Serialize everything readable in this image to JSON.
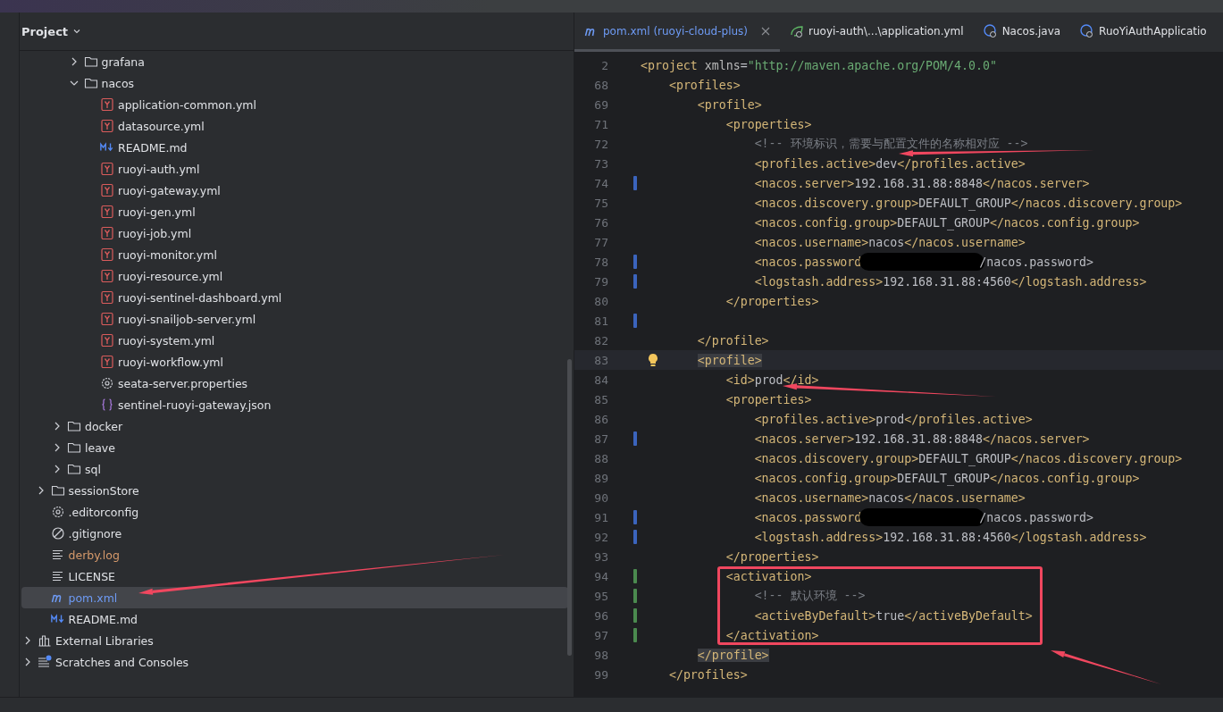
{
  "project_panel": {
    "title": "Project",
    "tree": [
      {
        "children": [
          {
            "children": [
              {
                "children": [
                  {
                    "label": "grafana",
                    "kind": "folder",
                    "expanded": false,
                    "selected": false
                  },
                  {
                    "label": "nacos",
                    "kind": "folder",
                    "expanded": true,
                    "selected": false,
                    "children": [
                      {
                        "label": "application-common.yml",
                        "kind": "yaml",
                        "selected": false
                      },
                      {
                        "label": "datasource.yml",
                        "kind": "yaml",
                        "selected": false
                      },
                      {
                        "label": "README.md",
                        "kind": "markdown",
                        "selected": false
                      },
                      {
                        "label": "ruoyi-auth.yml",
                        "kind": "yaml",
                        "selected": false
                      },
                      {
                        "label": "ruoyi-gateway.yml",
                        "kind": "yaml",
                        "selected": false
                      },
                      {
                        "label": "ruoyi-gen.yml",
                        "kind": "yaml",
                        "selected": false
                      },
                      {
                        "label": "ruoyi-job.yml",
                        "kind": "yaml",
                        "selected": false
                      },
                      {
                        "label": "ruoyi-monitor.yml",
                        "kind": "yaml",
                        "selected": false
                      },
                      {
                        "label": "ruoyi-resource.yml",
                        "kind": "yaml",
                        "selected": false
                      },
                      {
                        "label": "ruoyi-sentinel-dashboard.yml",
                        "kind": "yaml",
                        "selected": false
                      },
                      {
                        "label": "ruoyi-snailjob-server.yml",
                        "kind": "yaml",
                        "selected": false
                      },
                      {
                        "label": "ruoyi-system.yml",
                        "kind": "yaml",
                        "selected": false
                      },
                      {
                        "label": "ruoyi-workflow.yml",
                        "kind": "yaml",
                        "selected": false
                      },
                      {
                        "label": "seata-server.properties",
                        "kind": "settings",
                        "selected": false
                      },
                      {
                        "label": "sentinel-ruoyi-gateway.json",
                        "kind": "json",
                        "selected": false
                      }
                    ]
                  }
                ]
              },
              {
                "label": "docker",
                "kind": "folder",
                "expanded": false,
                "selected": false
              },
              {
                "label": "leave",
                "kind": "folder",
                "expanded": false,
                "selected": false
              },
              {
                "label": "sql",
                "kind": "folder",
                "expanded": false,
                "selected": false
              }
            ]
          },
          {
            "label": "sessionStore",
            "kind": "folder",
            "expanded": false,
            "selected": false
          },
          {
            "label": ".editorconfig",
            "kind": "settings",
            "selected": false
          },
          {
            "label": ".gitignore",
            "kind": "ignore",
            "selected": false
          },
          {
            "label": "derby.log",
            "kind": "text",
            "ignored": true,
            "selected": false
          },
          {
            "label": "LICENSE",
            "kind": "text",
            "selected": false
          },
          {
            "label": "pom.xml",
            "kind": "maven",
            "selected": true
          },
          {
            "label": "README.md",
            "kind": "markdown",
            "selected": false
          }
        ]
      },
      {
        "label": "External Libraries",
        "kind": "libraries",
        "expanded": false,
        "selected": false
      },
      {
        "label": "Scratches and Consoles",
        "kind": "scratches",
        "expanded": false,
        "selected": false
      }
    ]
  },
  "editor": {
    "tabs": [
      {
        "label": "pom.xml (ruoyi-cloud-plus)",
        "kind": "maven",
        "selected": true
      },
      {
        "label": "ruoyi-auth\\...\\application.yml",
        "kind": "spring",
        "selected": false
      },
      {
        "label": "Nacos.java",
        "kind": "java",
        "selected": false
      },
      {
        "label": "RuoYiAuthApplicatio",
        "kind": "java",
        "selected": false
      }
    ],
    "lines": [
      {
        "number": "2",
        "text": "<project xmlns=\"http://maven.apache.org/POM/4.0.0\""
      },
      {
        "number": "68",
        "text": "    <profiles>"
      },
      {
        "number": "69",
        "text": "        <profile>"
      },
      {
        "number": "71",
        "text": "            <properties>"
      },
      {
        "number": "72",
        "text": "                <!-- 环境标识，需要与配置文件的名称相对应 -->"
      },
      {
        "number": "73",
        "text": "                <profiles.active>dev</profiles.active>"
      },
      {
        "number": "74",
        "text": "                <nacos.server>192.168.31.88:8848</nacos.server>",
        "kind": "modified"
      },
      {
        "number": "75",
        "text": "                <nacos.discovery.group>DEFAULT_GROUP</nacos.discovery.group>"
      },
      {
        "number": "76",
        "text": "                <nacos.config.group>DEFAULT_GROUP</nacos.config.group>"
      },
      {
        "number": "77",
        "text": "                <nacos.username>nacos</nacos.username>"
      },
      {
        "number": "78",
        "text": "                <nacos.password",
        "redacted": true,
        "text_after": "/nacos.password>",
        "kind": "modified"
      },
      {
        "number": "79",
        "text": "                <logstash.address>192.168.31.88:4560</logstash.address>",
        "kind": "modified"
      },
      {
        "number": "80",
        "text": "            </properties>"
      },
      {
        "number": "81",
        "kind": "modified"
      },
      {
        "number": "82",
        "text": "        </profile>"
      },
      {
        "number": "83",
        "text": "        <profile>",
        "current": true,
        "matched_tag": true,
        "bulb": true
      },
      {
        "number": "84",
        "text": "            <id>prod</id>"
      },
      {
        "number": "85",
        "text": "            <properties>"
      },
      {
        "number": "86",
        "text": "                <profiles.active>prod</profiles.active>"
      },
      {
        "number": "87",
        "text": "                <nacos.server>192.168.31.88:8848</nacos.server>",
        "kind": "modified"
      },
      {
        "number": "88",
        "text": "                <nacos.discovery.group>DEFAULT_GROUP</nacos.discovery.group>"
      },
      {
        "number": "89",
        "text": "                <nacos.config.group>DEFAULT_GROUP</nacos.config.group>"
      },
      {
        "number": "90",
        "text": "                <nacos.username>nacos</nacos.username>"
      },
      {
        "number": "91",
        "text": "                <nacos.password",
        "redacted": true,
        "text_after": "/nacos.password>",
        "kind": "modified"
      },
      {
        "number": "92",
        "text": "                <logstash.address>192.168.31.88:4560</logstash.address>",
        "kind": "modified"
      },
      {
        "number": "93",
        "text": "            </properties>"
      },
      {
        "number": "94",
        "text": "            <activation>",
        "kind": "added",
        "boxed": true
      },
      {
        "number": "95",
        "text": "                <!-- 默认环境 -->",
        "kind": "added",
        "boxed": true
      },
      {
        "number": "96",
        "text": "                <activeByDefault>true</activeByDefault>",
        "kind": "added",
        "boxed": true
      },
      {
        "number": "97",
        "text": "            </activation>",
        "kind": "added",
        "boxed": true
      },
      {
        "number": "98",
        "text": "        </profile>",
        "matched_tag": true
      },
      {
        "number": "99",
        "text": "    </profiles>"
      }
    ]
  }
}
